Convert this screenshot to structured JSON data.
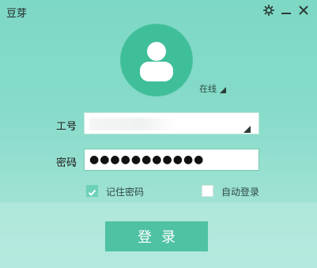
{
  "window": {
    "title": "豆芽",
    "icons": {
      "settings": "gear-icon",
      "minimize": "minimize-icon",
      "close": "close-icon"
    }
  },
  "profile": {
    "avatar_icon": "user-avatar-icon",
    "status_label": "在线"
  },
  "form": {
    "account_label": "工号",
    "password_label": "密码",
    "colon": "：",
    "account_value": "",
    "password_mask": "●●●●●●●●●●●"
  },
  "options": {
    "remember_label": "记住密码",
    "remember_checked": true,
    "auto_login_label": "自动登录",
    "auto_login_checked": false
  },
  "actions": {
    "login_label": "登录"
  },
  "colors": {
    "accent": "#4fc2a3",
    "avatar_bg": "#3fbe9a",
    "background": "#86dbc9"
  }
}
